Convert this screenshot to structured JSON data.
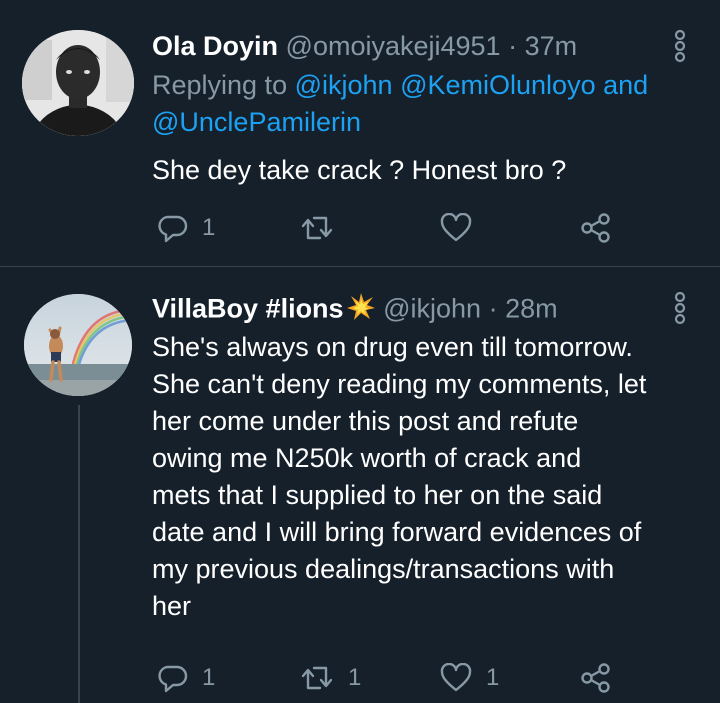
{
  "tweet1": {
    "display_name": "Ola Doyin",
    "handle": "@omoiyakeji4951",
    "separator": "·",
    "time": "37m",
    "replying_prefix": "Replying to",
    "mention_1": "@ikjohn",
    "mention_2": "@KemiOlunloyo",
    "mention_joiner": "and",
    "mention_3": "@UnclePamilerin",
    "text": "She dey take crack ? Honest bro ?",
    "reply_count": "1",
    "retweet_count": "",
    "like_count": ""
  },
  "tweet2": {
    "display_name": "VillaBoy #lions",
    "handle": "@ikjohn",
    "separator": "·",
    "time": "28m",
    "text_lines": [
      "She's always on drug even till tomorrow.",
      "She can't deny reading my comments, let",
      "her come under this post and refute",
      "owing me N250k worth of crack and",
      "mets that I supplied to her on the said",
      "date and I will bring forward evidences of",
      "my previous dealings/transactions with",
      "her"
    ],
    "reply_count": "1",
    "retweet_count": "1",
    "like_count": "1"
  },
  "colors": {
    "background": "#15202b",
    "secondary_text": "#8899a6",
    "link": "#1da1f2",
    "divider": "#38444d"
  },
  "icons": [
    "reply-icon",
    "retweet-icon",
    "like-icon",
    "share-icon",
    "more-options-icon",
    "collision-emoji"
  ]
}
